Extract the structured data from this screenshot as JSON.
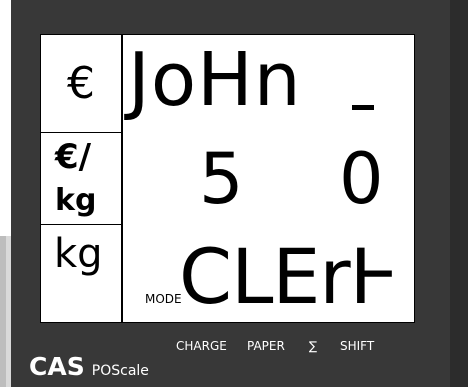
{
  "display": {
    "unit_top": "€",
    "unit_mid_line1": "€/",
    "unit_mid_line2": "kg",
    "unit_bottom": "kg",
    "name_text": "JoHn",
    "number_left": "5",
    "number_right": "0",
    "mode_label": "MODE",
    "clerk_text": "CLErⱵ"
  },
  "keys": {
    "charge": "CHARGE",
    "paper": "PAPER",
    "sigma": "∑",
    "shift": "SHIFT"
  },
  "brand": {
    "name": "CAS",
    "model": "POScale"
  },
  "colors": {
    "housing": "#383838",
    "lcd": "#ffffff",
    "text": "#000000"
  }
}
